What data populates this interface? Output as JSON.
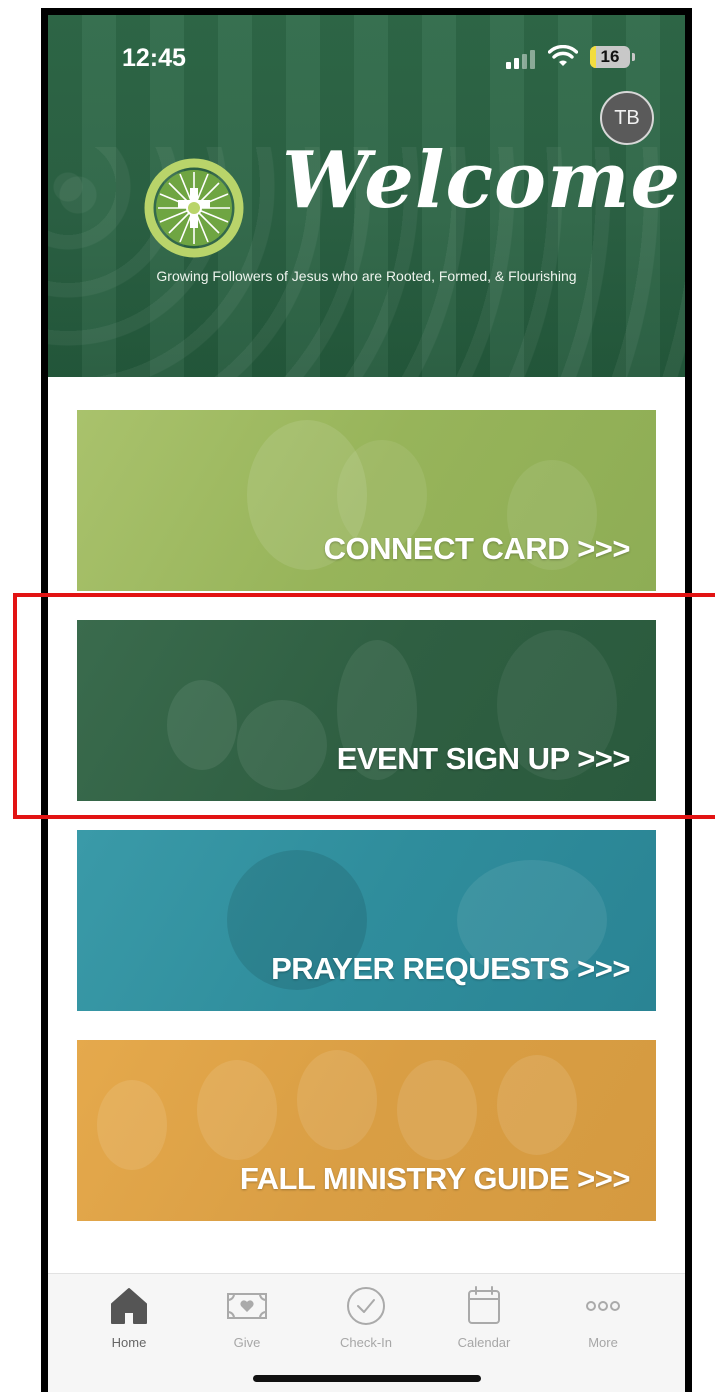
{
  "status_bar": {
    "time": "12:45",
    "battery": "16",
    "battery_level": 0.16
  },
  "profile": {
    "initials": "TB"
  },
  "hero": {
    "welcome": "Welcome",
    "tagline": "Growing Followers of Jesus who are Rooted, Formed, & Flourishing"
  },
  "banners": [
    {
      "label": "CONNECT CARD >>>",
      "color": "#9cb85f"
    },
    {
      "label": "EVENT SIGN UP >>>",
      "color": "#2f5f42"
    },
    {
      "label": "PRAYER REQUESTS >>>",
      "color": "#2f8d9c"
    },
    {
      "label": "FALL MINISTRY GUIDE >>>",
      "color": "#d99e44"
    }
  ],
  "tabbar": {
    "items": [
      {
        "label": "Home",
        "icon": "home-icon"
      },
      {
        "label": "Give",
        "icon": "give-icon"
      },
      {
        "label": "Check-In",
        "icon": "check-in-icon"
      },
      {
        "label": "Calendar",
        "icon": "calendar-icon"
      },
      {
        "label": "More",
        "icon": "more-icon"
      }
    ]
  },
  "colors": {
    "highlight": "#e21313",
    "hero": "#2c6445",
    "tab_active": "#555555",
    "tab_inactive": "#a7a7a7"
  }
}
